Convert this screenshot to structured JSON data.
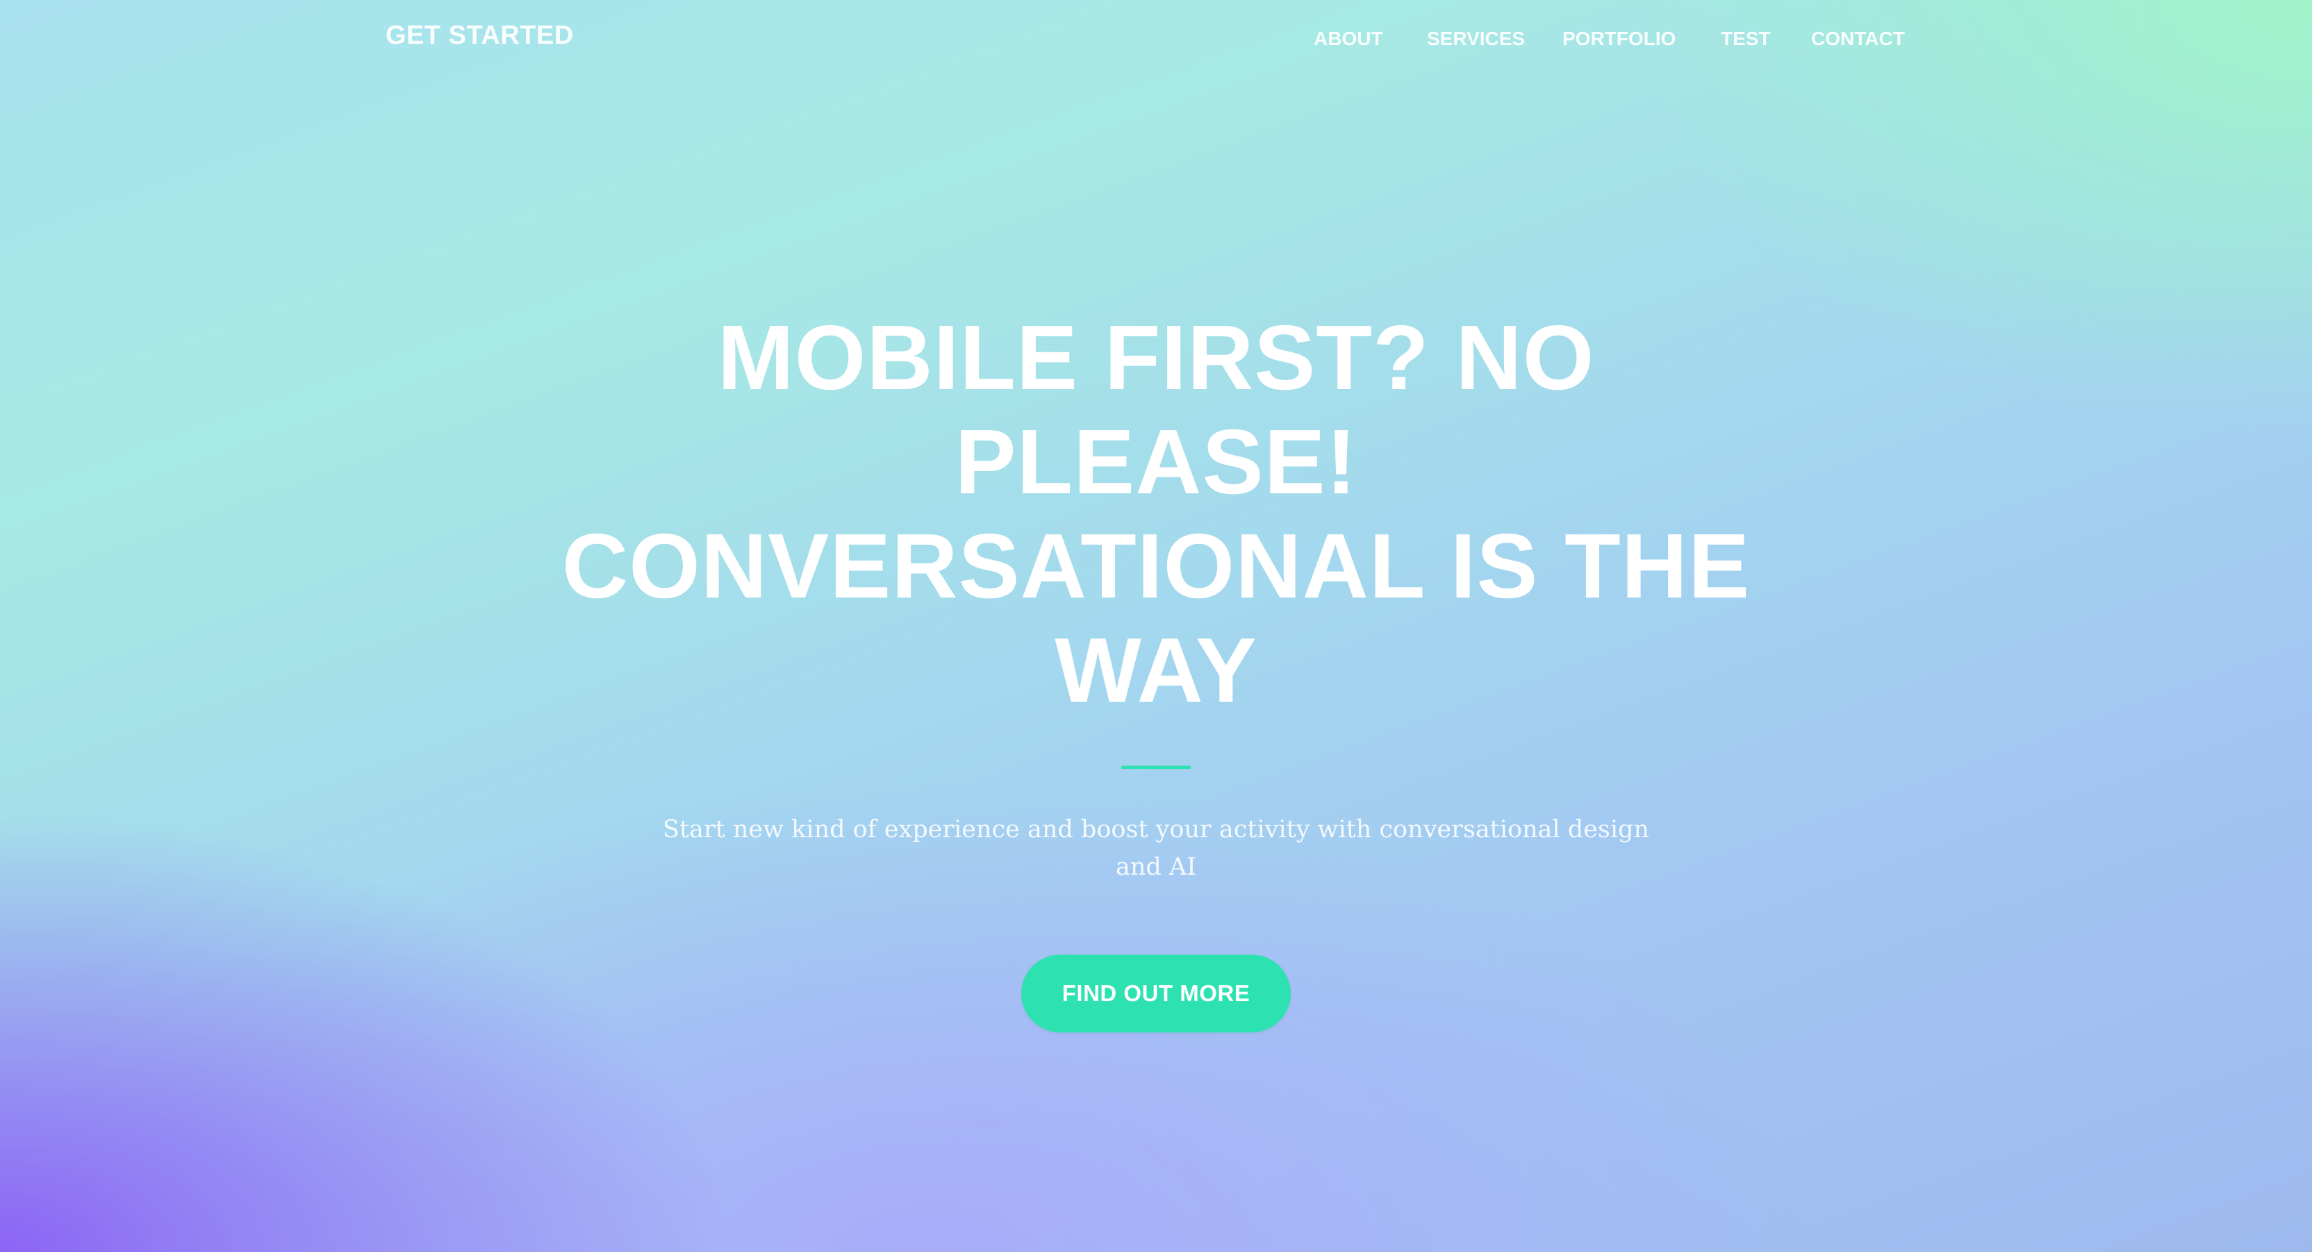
{
  "navbar": {
    "brand": "GET STARTED",
    "links": [
      {
        "label": "ABOUT"
      },
      {
        "label": "SERVICES"
      },
      {
        "label": "PORTFOLIO"
      },
      {
        "label": "TEST"
      },
      {
        "label": "CONTACT"
      }
    ]
  },
  "hero": {
    "headline_line1": "MOBILE FIRST? NO PLEASE!",
    "headline_line2": "CONVERSATIONAL IS THE",
    "headline_line3": "WAY",
    "subtitle": "Start new kind of experience and boost your activity with conversational design and AI",
    "cta_label": "FIND OUT MORE"
  },
  "colors": {
    "accent": "#2de2b0",
    "text": "#ffffff",
    "gradient_top_right": "#a0f5c8",
    "gradient_bottom_left": "#8c64f5"
  }
}
